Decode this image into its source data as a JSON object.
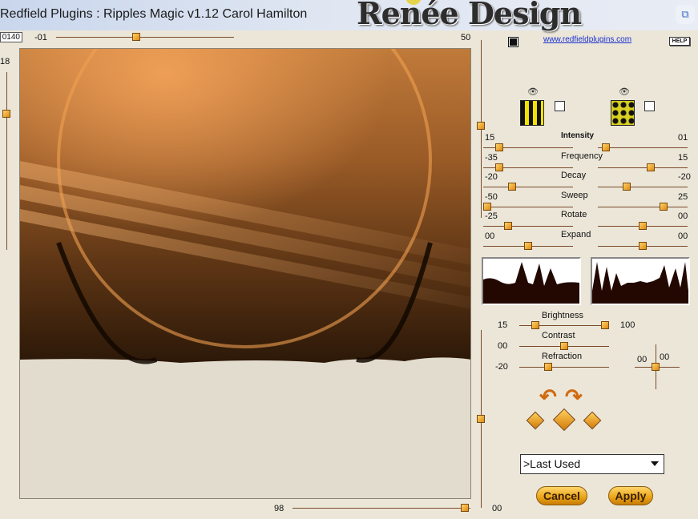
{
  "window": {
    "title": "Redfield Plugins : Ripples Magic v1.12   Carol Hamilton"
  },
  "watermark": "Renée Design",
  "top_slider": {
    "field_value": "0140",
    "min_label": "-01",
    "max_label": "50",
    "level": 0.45
  },
  "left_slider": {
    "label": "18",
    "level": 0.22
  },
  "bottom_slider": {
    "min_label": "98",
    "max_label": "00",
    "level": 0.99
  },
  "right_vslider": {
    "level": 0.15
  },
  "right_vslider2": {
    "level": 0.5
  },
  "link": "www.redfieldplugins.com",
  "help_label": "HELP",
  "patterns": [
    {
      "name": "vertical-stripes",
      "icon": "eye-icon",
      "checked": false
    },
    {
      "name": "checker",
      "icon": "eye-icon",
      "checked": false
    }
  ],
  "params": [
    {
      "label": "Intensity",
      "left_value": "15",
      "right_value": "01",
      "left_level": 0.15,
      "right_level": 0.05
    },
    {
      "label": "Frequency",
      "left_value": "-35",
      "right_value": "15",
      "left_level": 0.15,
      "right_level": 0.6
    },
    {
      "label": "Decay",
      "left_value": "-20",
      "right_value": "-20",
      "left_level": 0.3,
      "right_level": 0.3
    },
    {
      "label": "Sweep",
      "left_value": "-50",
      "right_value": "25",
      "left_level": 0.0,
      "right_level": 0.75
    },
    {
      "label": "Rotate",
      "left_value": "-25",
      "right_value": "00",
      "left_level": 0.25,
      "right_level": 0.5
    },
    {
      "label": "Expand",
      "left_value": "00",
      "right_value": "00",
      "left_level": 0.5,
      "right_level": 0.5
    }
  ],
  "adjust": {
    "brightness": {
      "label": "Brightness",
      "min": "15",
      "max": "100",
      "level_a": 0.15,
      "level_b": 1.0
    },
    "contrast": {
      "label": "Contrast",
      "value": "00",
      "level": 0.5
    },
    "refraction": {
      "label": "Refraction",
      "value": "-20",
      "level": 0.3
    }
  },
  "offset": {
    "x": "00",
    "y": "00"
  },
  "preset": {
    "selected": ">Last Used"
  },
  "buttons": {
    "cancel": "Cancel",
    "apply": "Apply"
  },
  "colors": {
    "accent": "#e9a315",
    "track": "#7a4a2a",
    "panel": "#ebe6d8"
  }
}
